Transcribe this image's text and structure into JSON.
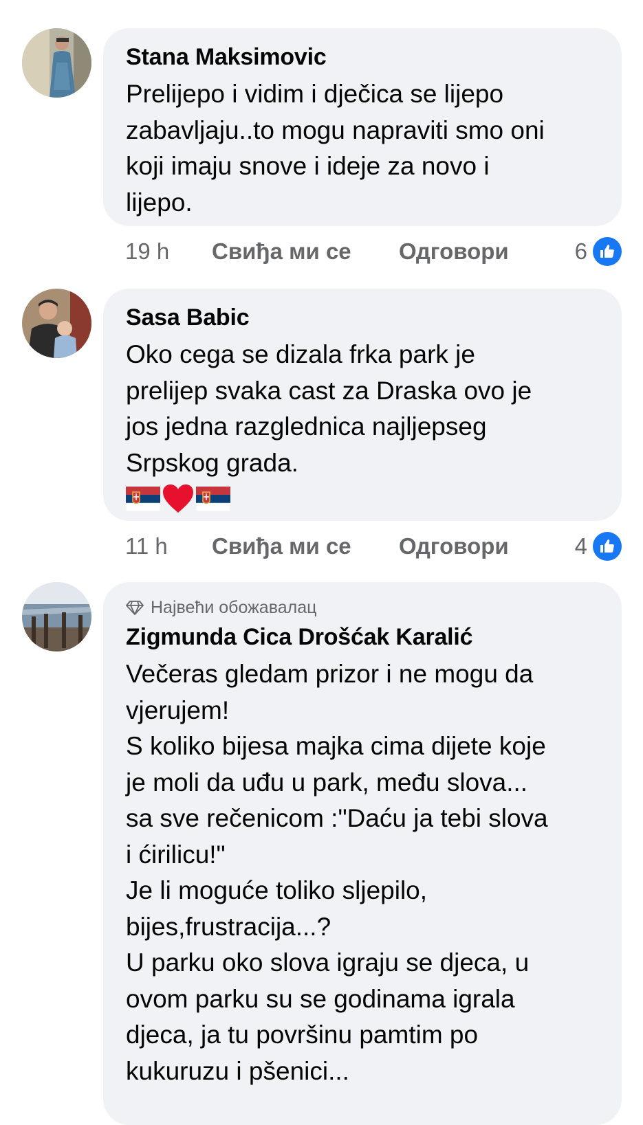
{
  "comments": [
    {
      "author": "Stana Maksimovic",
      "text": "Prelijepo i vidim i dječica se lijepo\nzabavljaju..to mogu napraviti smo oni\nkoji imaju snove i ideje za novo i\nlijepo.",
      "time": "19 h",
      "like_label": "Свиђа ми се",
      "reply_label": "Одговори",
      "reaction_count": "6",
      "reaction_icon": "thumbs-up-icon"
    },
    {
      "author": "Sasa Babic",
      "text": "Oko cega se dizala frka park je\nprelijep svaka cast za Draska ovo je\njos jedna razglednica najljepseg\nSrpskog grada.",
      "emoji": [
        "serbia-flag-icon",
        "red-heart-icon",
        "serbia-flag-icon"
      ],
      "time": "11 h",
      "like_label": "Свиђа ми се",
      "reply_label": "Одговори",
      "reaction_count": "4",
      "reaction_icon": "thumbs-up-icon"
    },
    {
      "badge": "Највећи обожавалац",
      "author": "Zigmunda Cica Drošćak Karalić",
      "text": "Večeras gledam prizor i ne mogu da\nvjerujem!\nS koliko bijesa majka cima dijete koje\nje moli da uđu u park, među slova...\nsa sve rečenicom :\"Daću ja tebi slova\ni ćirilicu!\"\nJe li moguće toliko sljepilo,\nbijes,frustracija...?\nU parku oko slova igraju se djeca, u\novom parku su se godinama igrala\ndjeca, ja tu površinu pamtim po\nkukuruzu i pšenici..."
    }
  ],
  "colors": {
    "bubble": "#f0f2f5",
    "meta": "#65676b",
    "like_blue": "#1877f2",
    "text": "#050505"
  }
}
